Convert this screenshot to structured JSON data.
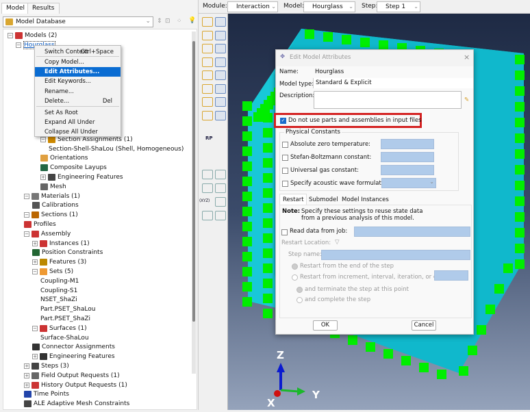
{
  "left_panel": {
    "tabs": [
      "Model",
      "Results"
    ],
    "database_selector": "Model Database",
    "tree": [
      {
        "i": 0,
        "lvl": 0,
        "exp": "-",
        "label": "Models (2)",
        "color": "#c33"
      },
      {
        "i": 1,
        "lvl": 1,
        "exp": "-",
        "label": "Hourglass",
        "selected": true
      },
      {
        "i": 11,
        "lvl": 4,
        "exp": "-",
        "label": "Section Assignments (1)",
        "color": "#c80"
      },
      {
        "i": 12,
        "lvl": 5,
        "exp": "",
        "label": "Section-Shell-ShaLou (Shell, Homogeneous)",
        "color": ""
      },
      {
        "i": 13,
        "lvl": 4,
        "exp": "",
        "label": "Orientations",
        "color": "#e0a040"
      },
      {
        "i": 14,
        "lvl": 4,
        "exp": "",
        "label": "Composite Layups",
        "color": "#264"
      },
      {
        "i": 15,
        "lvl": 4,
        "exp": "+",
        "label": "Engineering Features",
        "color": "#444"
      },
      {
        "i": 16,
        "lvl": 4,
        "exp": "",
        "label": "Mesh",
        "color": "#666"
      },
      {
        "i": 17,
        "lvl": 2,
        "exp": "-",
        "label": "Materials (1)",
        "color": "#777"
      },
      {
        "i": 18,
        "lvl": 3,
        "exp": "",
        "label": "Calibrations",
        "color": "#555"
      },
      {
        "i": 19,
        "lvl": 2,
        "exp": "-",
        "label": "Sections (1)",
        "color": "#b60"
      },
      {
        "i": 20,
        "lvl": 2,
        "exp": "",
        "label": "Profiles",
        "color": "#c33"
      },
      {
        "i": 21,
        "lvl": 2,
        "exp": "-",
        "label": "Assembly",
        "color": "#c33"
      },
      {
        "i": 22,
        "lvl": 3,
        "exp": "+",
        "label": "Instances (1)",
        "color": "#c33"
      },
      {
        "i": 23,
        "lvl": 3,
        "exp": "",
        "label": "Position Constraints",
        "color": "#263"
      },
      {
        "i": 24,
        "lvl": 3,
        "exp": "+",
        "label": "Features (3)",
        "color": "#b80"
      },
      {
        "i": 25,
        "lvl": 3,
        "exp": "-",
        "label": "Sets (5)",
        "color": "#e93"
      },
      {
        "i": 26,
        "lvl": 4,
        "exp": "",
        "label": "Coupling-M1",
        "color": ""
      },
      {
        "i": 27,
        "lvl": 4,
        "exp": "",
        "label": "Coupling-S1",
        "color": ""
      },
      {
        "i": 28,
        "lvl": 4,
        "exp": "",
        "label": "NSET_ShaZi",
        "color": ""
      },
      {
        "i": 29,
        "lvl": 4,
        "exp": "",
        "label": "Part.PSET_ShaLou",
        "color": ""
      },
      {
        "i": 30,
        "lvl": 4,
        "exp": "",
        "label": "Part.PSET_ShaZi",
        "color": ""
      },
      {
        "i": 31,
        "lvl": 3,
        "exp": "-",
        "label": "Surfaces (1)",
        "color": "#c33"
      },
      {
        "i": 32,
        "lvl": 4,
        "exp": "",
        "label": "Surface-ShaLou",
        "color": ""
      },
      {
        "i": 33,
        "lvl": 3,
        "exp": "",
        "label": "Connector Assignments",
        "color": "#333"
      },
      {
        "i": 34,
        "lvl": 3,
        "exp": "+",
        "label": "Engineering Features",
        "color": "#333"
      },
      {
        "i": 35,
        "lvl": 2,
        "exp": "+",
        "label": "Steps (3)",
        "color": "#444"
      },
      {
        "i": 36,
        "lvl": 2,
        "exp": "+",
        "label": "Field Output Requests (1)",
        "color": "#666"
      },
      {
        "i": 37,
        "lvl": 2,
        "exp": "+",
        "label": "History Output Requests (1)",
        "color": "#c33"
      },
      {
        "i": 38,
        "lvl": 2,
        "exp": "",
        "label": "Time Points",
        "color": "#24a"
      },
      {
        "i": 39,
        "lvl": 2,
        "exp": "",
        "label": "ALE Adaptive Mesh Constraints",
        "color": "#444"
      }
    ]
  },
  "context_menu": {
    "items": [
      {
        "label": "Switch Context",
        "shortcut": "Ctrl+Space"
      },
      {
        "label": "Copy Model...",
        "shortcut": ""
      },
      {
        "label": "Edit Attributes...",
        "shortcut": "",
        "highlighted": true
      },
      {
        "label": "Edit Keywords...",
        "shortcut": ""
      },
      {
        "label": "Rename...",
        "shortcut": ""
      },
      {
        "label": "Delete...",
        "shortcut": "Del"
      },
      {
        "label": "Set As Root",
        "shortcut": ""
      },
      {
        "label": "Expand All Under",
        "shortcut": ""
      },
      {
        "label": "Collapse All Under",
        "shortcut": ""
      }
    ]
  },
  "context_bar": {
    "module_label": "Module:",
    "module": "Interaction",
    "model_label": "Model:",
    "model": "Hourglass",
    "step_label": "Step:",
    "step": "Step 1"
  },
  "toolbar": {
    "rp_label": "RP",
    "xyz_label": "(XYZ)"
  },
  "dialog": {
    "title": "Edit Model Attributes",
    "name_label": "Name:",
    "name": "Hourglass",
    "type_label": "Model type:",
    "type": "Standard & Explicit",
    "desc_label": "Description:",
    "desc": "",
    "no_parts_label": "Do not use parts and assemblies in input files",
    "no_parts_checked": true,
    "physical_title": "Physical Constants",
    "constants": [
      "Absolute zero temperature:",
      "Stefan-Boltzmann constant:",
      "Universal gas constant:",
      "Specify acoustic wave formulation:"
    ],
    "tabs": [
      "Restart",
      "Submodel",
      "Model Instances"
    ],
    "note_label": "Note:",
    "note_line1": "Specify these settings to reuse state data",
    "note_line2": "from a previous analysis of this model.",
    "read_label": "Read data from job:",
    "restart_location": "Restart Location:",
    "step_name": "Step name:",
    "radio1": "Restart from the end of the step",
    "radio2": "Restart from increment, interval, iteration, or cycle:",
    "sub1": "and terminate the step at this point",
    "sub2": "and complete the step",
    "ok": "OK",
    "cancel": "Cancel"
  },
  "triad": {
    "z": "Z",
    "y": "Y",
    "x": "X"
  },
  "colors": {
    "highlight_box": "#d42020",
    "mesh_face": "#18c8d8",
    "mesh_node": "#00ee00"
  }
}
